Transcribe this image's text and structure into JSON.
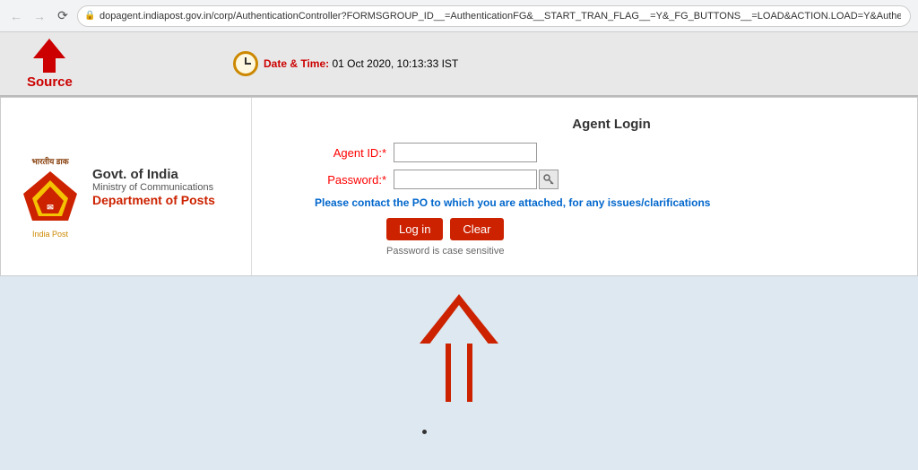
{
  "browser": {
    "url": "dopagent.indiapost.gov.in/corp/AuthenticationController?FORMSGROUP_ID__=AuthenticationFG&__START_TRAN_FLAG__=Y&_FG_BUTTONS__=LOAD&ACTION.LOAD=Y&AuthenticationFG..",
    "back_btn": "←",
    "forward_btn": "→",
    "reload_btn": "↻"
  },
  "toolbar": {
    "source_label": "Source",
    "datetime_label": "Date & Time:",
    "datetime_value": "01 Oct 2020, 10:13:33 IST"
  },
  "logo": {
    "emblem_text": "भारतीय डाक",
    "gov_india": "Govt. of India",
    "ministry": "Ministry of Communications",
    "department": "Department of Posts",
    "india_post": "India Post"
  },
  "form": {
    "title": "Agent Login",
    "agent_id_label": "Agent ID:",
    "agent_id_placeholder": "",
    "password_label": "Password:",
    "password_placeholder": "",
    "notice": "Please contact the PO to which you are attached, for any issues/clarifications",
    "login_button": "Log in",
    "clear_button": "Clear",
    "case_sensitive_note": "Password is case sensitive"
  }
}
